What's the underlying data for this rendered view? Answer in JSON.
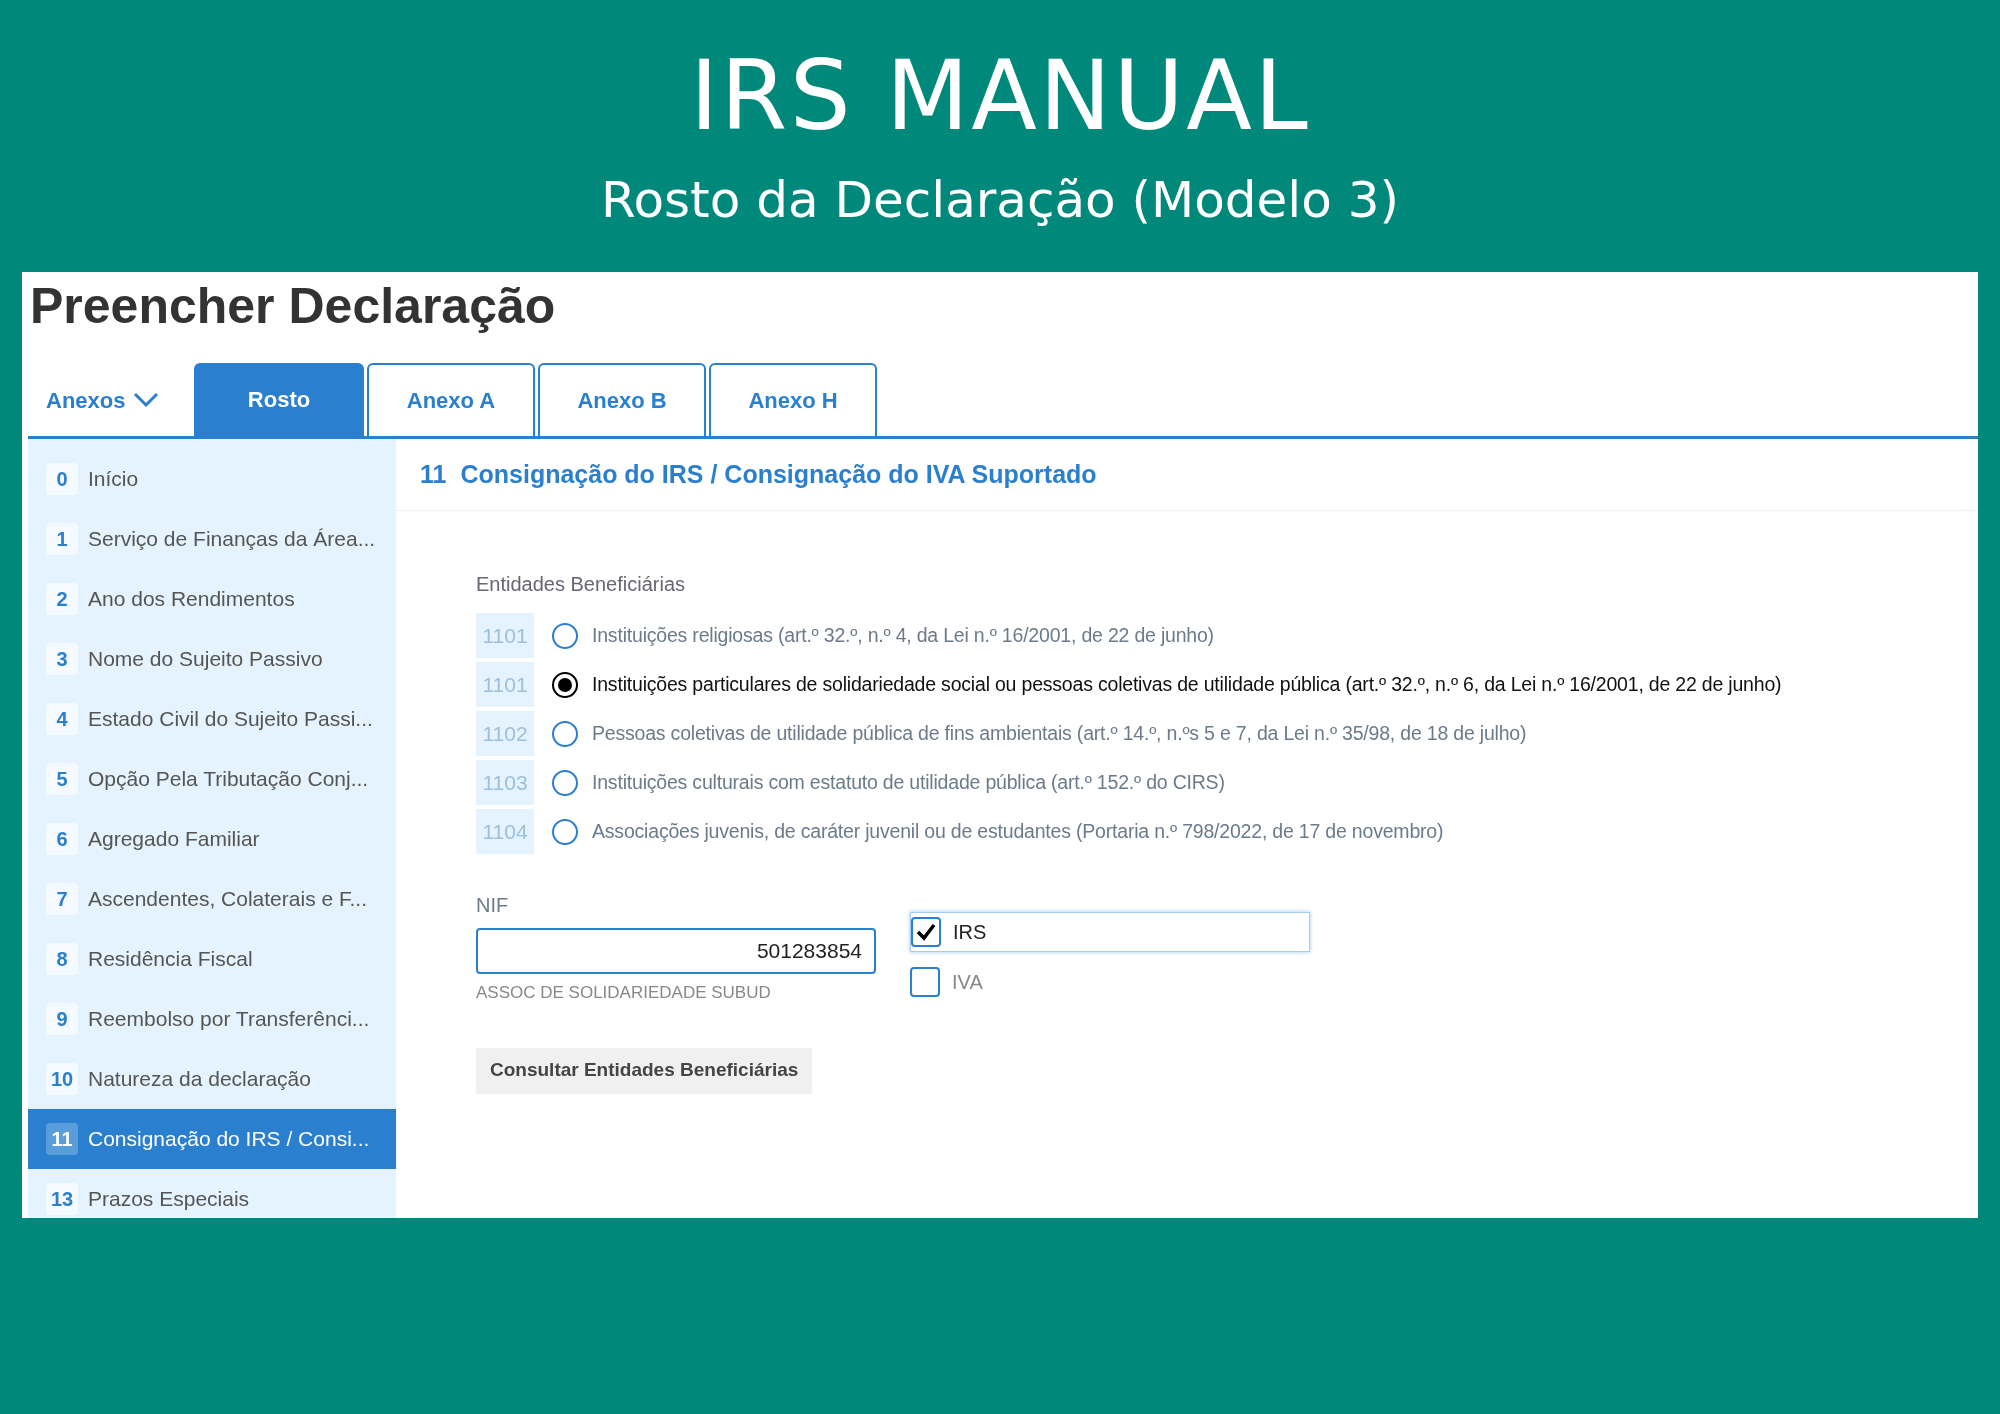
{
  "banner": {
    "title": "IRS MANUAL",
    "subtitle": "Rosto da Declaração (Modelo 3)"
  },
  "page_title": "Preencher Declaração",
  "annexes_menu": {
    "label": "Anexos"
  },
  "tabs": [
    {
      "label": "Rosto",
      "selected": true
    },
    {
      "label": "Anexo A",
      "selected": false
    },
    {
      "label": "Anexo B",
      "selected": false
    },
    {
      "label": "Anexo H",
      "selected": false
    }
  ],
  "sidebar": {
    "items": [
      {
        "number": "0",
        "label": "Início",
        "selected": false
      },
      {
        "number": "1",
        "label": "Serviço de Finanças da Área...",
        "selected": false
      },
      {
        "number": "2",
        "label": "Ano dos Rendimentos",
        "selected": false
      },
      {
        "number": "3",
        "label": "Nome do Sujeito Passivo",
        "selected": false
      },
      {
        "number": "4",
        "label": "Estado Civil do Sujeito Passi...",
        "selected": false
      },
      {
        "number": "5",
        "label": "Opção Pela Tributação Conj...",
        "selected": false
      },
      {
        "number": "6",
        "label": "Agregado Familiar",
        "selected": false
      },
      {
        "number": "7",
        "label": "Ascendentes, Colaterais e F...",
        "selected": false
      },
      {
        "number": "8",
        "label": "Residência Fiscal",
        "selected": false
      },
      {
        "number": "9",
        "label": "Reembolso por Transferênci...",
        "selected": false
      },
      {
        "number": "10",
        "label": "Natureza da declaração",
        "selected": false
      },
      {
        "number": "11",
        "label": "Consignação do IRS / Consi...",
        "selected": true
      },
      {
        "number": "13",
        "label": "Prazos Especiais",
        "selected": false
      }
    ]
  },
  "section": {
    "number": "11",
    "title": "Consignação do IRS / Consignação do IVA Suportado"
  },
  "entities": {
    "label": "Entidades Beneficiárias",
    "options": [
      {
        "code": "1101",
        "label": "Instituições religiosas (art.º 32.º, n.º 4, da Lei n.º 16/2001, de 22 de junho)",
        "selected": false
      },
      {
        "code": "1101",
        "label": "Instituições particulares de solidariedade social ou pessoas coletivas de utilidade pública (art.º 32.º, n.º 6, da Lei n.º 16/2001, de 22 de junho)",
        "selected": true
      },
      {
        "code": "1102",
        "label": "Pessoas coletivas de utilidade pública de fins ambientais (art.º 14.º, n.ºs 5 e 7, da Lei n.º 35/98, de 18 de julho)",
        "selected": false
      },
      {
        "code": "1103",
        "label": "Instituições culturais com estatuto de utilidade pública (art.º 152.º do CIRS)",
        "selected": false
      },
      {
        "code": "1104",
        "label": "Associações juvenis, de caráter juvenil ou de estudantes (Portaria n.º 798/2022, de 17 de novembro)",
        "selected": false
      }
    ]
  },
  "nif": {
    "label": "NIF",
    "value": "501283854",
    "entity_name": "ASSOC DE SOLIDARIEDADE SUBUD"
  },
  "checkboxes": [
    {
      "label": "IRS",
      "checked": true
    },
    {
      "label": "IVA",
      "checked": false
    }
  ],
  "button": "Consultar Entidades Beneficiárias"
}
